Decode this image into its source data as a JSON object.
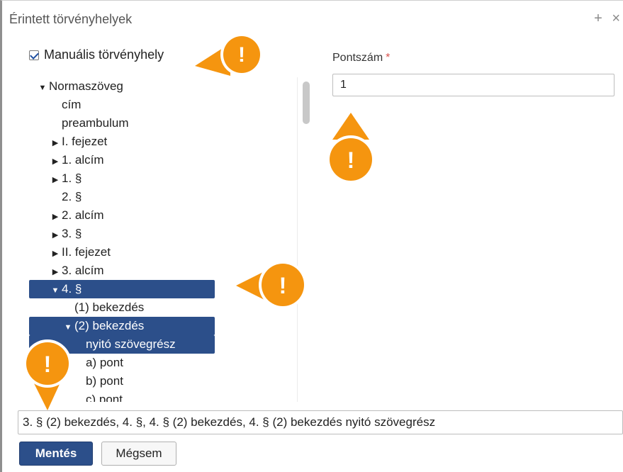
{
  "dialog": {
    "title": "Érintett törvényhelyek",
    "actions": [
      "+",
      "×"
    ]
  },
  "manual": {
    "label": "Manuális törvényhely",
    "checked": true
  },
  "tree": {
    "items": [
      {
        "label": "Normaszöveg",
        "caret": "down",
        "selected": false,
        "indent": 0
      },
      {
        "label": "cím",
        "caret": "none",
        "selected": false,
        "indent": 1
      },
      {
        "label": "preambulum",
        "caret": "none",
        "selected": false,
        "indent": 1
      },
      {
        "label": "I. fejezet",
        "caret": "right",
        "selected": false,
        "indent": 1
      },
      {
        "label": "1. alcím",
        "caret": "right",
        "selected": false,
        "indent": 1
      },
      {
        "label": "1. §",
        "caret": "right",
        "selected": false,
        "indent": 1
      },
      {
        "label": "2. §",
        "caret": "none",
        "selected": false,
        "indent": 1
      },
      {
        "label": "2. alcím",
        "caret": "right",
        "selected": false,
        "indent": 1
      },
      {
        "label": "3. §",
        "caret": "right",
        "selected": false,
        "indent": 1
      },
      {
        "label": "II. fejezet",
        "caret": "right",
        "selected": false,
        "indent": 1
      },
      {
        "label": "3. alcím",
        "caret": "right",
        "selected": false,
        "indent": 1
      },
      {
        "label": "4. §",
        "caret": "down",
        "selected": true,
        "indent": 1
      },
      {
        "label": "(1) bekezdés",
        "caret": "none",
        "selected": false,
        "indent": 2
      },
      {
        "label": "(2) bekezdés",
        "caret": "down",
        "selected": true,
        "indent": 2
      },
      {
        "label": "nyitó szövegrész",
        "caret": "none",
        "selected": true,
        "indent": 3
      },
      {
        "label": "a) pont",
        "caret": "none",
        "selected": false,
        "indent": 3
      },
      {
        "label": "b) pont",
        "caret": "none",
        "selected": false,
        "indent": 3
      },
      {
        "label": "c) pont",
        "caret": "none",
        "selected": false,
        "indent": 3
      }
    ]
  },
  "pontszam": {
    "label": "Pontszám",
    "required_mark": "*",
    "value": "1"
  },
  "result": {
    "value": "3. § (2) bekezdés, 4. §, 4. § (2) bekezdés, 4. § (2) bekezdés nyitó szövegrész"
  },
  "buttons": {
    "save": "Mentés",
    "cancel": "Mégsem"
  },
  "callouts": {
    "color": "#f5950f",
    "glyph": "!"
  },
  "colors": {
    "selection": "#2c4f8a",
    "required": "#d9534f"
  }
}
